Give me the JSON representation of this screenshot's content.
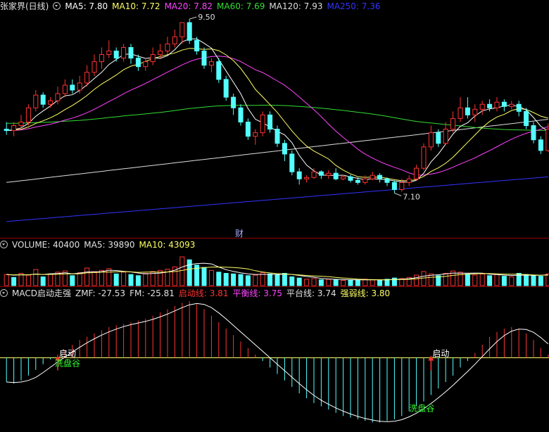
{
  "title": "张家界(日线)",
  "ma_legend": [
    {
      "label": "MA5: 7.80",
      "color": "#ffffff"
    },
    {
      "label": "MA10: 7.72",
      "color": "#ffff66"
    },
    {
      "label": "MA20: 7.82",
      "color": "#ff44ff"
    },
    {
      "label": "MA60: 7.69",
      "color": "#33dd33"
    },
    {
      "label": "MA120: 7.93",
      "color": "#dddddd"
    },
    {
      "label": "MA250: 7.36",
      "color": "#3333ff"
    }
  ],
  "volume_legend": [
    {
      "label": "VOLUME: 40400",
      "color": "#e0e0e0"
    },
    {
      "label": "MA5: 39890",
      "color": "#e0e0e0"
    },
    {
      "label": "MA10: 43093",
      "color": "#ffff66"
    }
  ],
  "macd_legend": [
    {
      "label": "MACD启动走强",
      "color": "#e0e0e0"
    },
    {
      "label": "ZMF: -27.53",
      "color": "#e0e0e0"
    },
    {
      "label": "FM: -25.81",
      "color": "#e0e0e0"
    },
    {
      "label": "启动线: 3.81",
      "color": "#ff3333"
    },
    {
      "label": "平衡线: 3.75",
      "color": "#ff44ff"
    },
    {
      "label": "平台线: 3.74",
      "color": "#e0e0e0"
    },
    {
      "label": "强弱线: 3.80",
      "color": "#ffff66"
    }
  ],
  "annotations": {
    "high": "9.50",
    "low": "7.10",
    "cai": "财",
    "qidong": "启动",
    "xipangu": "洗盘谷"
  },
  "colors": {
    "up": "#ff3333",
    "down": "#54ffff",
    "bg": "#000000"
  },
  "chart_data": [
    {
      "type": "candlestick",
      "ylim": [
        6.55,
        9.6
      ],
      "high_label": 9.5,
      "low_label": 7.1,
      "candles": [
        [
          8.0,
          7.98,
          8.1,
          7.92
        ],
        [
          7.98,
          8.05,
          8.1,
          7.9
        ],
        [
          8.05,
          8.1,
          8.2,
          8.0
        ],
        [
          8.1,
          8.3,
          8.35,
          8.05
        ],
        [
          8.3,
          8.48,
          8.55,
          8.25
        ],
        [
          8.48,
          8.35,
          8.52,
          8.3
        ],
        [
          8.35,
          8.4,
          8.45,
          8.3
        ],
        [
          8.4,
          8.5,
          8.6,
          8.35
        ],
        [
          8.5,
          8.62,
          8.7,
          8.45
        ],
        [
          8.62,
          8.55,
          8.7,
          8.5
        ],
        [
          8.55,
          8.65,
          8.75,
          8.5
        ],
        [
          8.65,
          8.8,
          8.9,
          8.6
        ],
        [
          8.8,
          8.95,
          9.05,
          8.75
        ],
        [
          8.95,
          9.05,
          9.15,
          8.85
        ],
        [
          9.05,
          9.1,
          9.25,
          9.0
        ],
        [
          9.1,
          9.0,
          9.15,
          8.95
        ],
        [
          9.0,
          9.15,
          9.2,
          8.95
        ],
        [
          9.15,
          9.0,
          9.2,
          8.92
        ],
        [
          9.0,
          8.88,
          9.05,
          8.82
        ],
        [
          8.88,
          8.95,
          9.0,
          8.82
        ],
        [
          8.95,
          9.05,
          9.15,
          8.9
        ],
        [
          9.05,
          9.1,
          9.2,
          9.0
        ],
        [
          9.1,
          9.2,
          9.3,
          9.05
        ],
        [
          9.2,
          9.3,
          9.4,
          9.15
        ],
        [
          9.3,
          9.5,
          9.5,
          9.2
        ],
        [
          9.5,
          9.25,
          9.55,
          9.2
        ],
        [
          9.25,
          9.1,
          9.3,
          9.05
        ],
        [
          9.1,
          8.9,
          9.15,
          8.85
        ],
        [
          8.9,
          8.95,
          9.0,
          8.8
        ],
        [
          8.95,
          8.7,
          9.0,
          8.65
        ],
        [
          8.7,
          8.45,
          8.75,
          8.4
        ],
        [
          8.45,
          8.3,
          8.5,
          8.2
        ],
        [
          8.3,
          8.1,
          8.35,
          8.05
        ],
        [
          8.1,
          7.9,
          8.15,
          7.85
        ],
        [
          7.9,
          7.95,
          8.0,
          7.78
        ],
        [
          7.95,
          8.2,
          8.25,
          7.9
        ],
        [
          8.2,
          8.0,
          8.25,
          7.95
        ],
        [
          8.0,
          7.8,
          8.05,
          7.75
        ],
        [
          7.8,
          7.65,
          7.85,
          7.55
        ],
        [
          7.65,
          7.4,
          7.7,
          7.35
        ],
        [
          7.4,
          7.3,
          7.45,
          7.22
        ],
        [
          7.3,
          7.32,
          7.35,
          7.25
        ],
        [
          7.32,
          7.4,
          7.45,
          7.3
        ],
        [
          7.4,
          7.35,
          7.42,
          7.3
        ],
        [
          7.35,
          7.38,
          7.42,
          7.3
        ],
        [
          7.38,
          7.3,
          7.45,
          7.28
        ],
        [
          7.3,
          7.33,
          7.36,
          7.28
        ],
        [
          7.33,
          7.28,
          7.36,
          7.25
        ],
        [
          7.28,
          7.25,
          7.32,
          7.22
        ],
        [
          7.25,
          7.3,
          7.35,
          7.22
        ],
        [
          7.3,
          7.35,
          7.4,
          7.28
        ],
        [
          7.35,
          7.3,
          7.38,
          7.25
        ],
        [
          7.3,
          7.25,
          7.32,
          7.2
        ],
        [
          7.25,
          7.15,
          7.28,
          7.1
        ],
        [
          7.15,
          7.25,
          7.3,
          7.12
        ],
        [
          7.25,
          7.3,
          7.35,
          7.2
        ],
        [
          7.3,
          7.45,
          7.5,
          7.28
        ],
        [
          7.45,
          7.75,
          7.8,
          7.42
        ],
        [
          7.75,
          7.95,
          8.05,
          7.7
        ],
        [
          7.95,
          7.8,
          8.0,
          7.75
        ],
        [
          7.8,
          8.0,
          8.1,
          7.78
        ],
        [
          8.0,
          8.15,
          8.25,
          7.95
        ],
        [
          8.15,
          8.3,
          8.45,
          8.1
        ],
        [
          8.3,
          8.2,
          8.45,
          8.15
        ],
        [
          8.2,
          8.28,
          8.35,
          8.1
        ],
        [
          8.28,
          8.35,
          8.4,
          8.2
        ],
        [
          8.35,
          8.3,
          8.42,
          8.25
        ],
        [
          8.3,
          8.38,
          8.45,
          8.25
        ],
        [
          8.38,
          8.32,
          8.42,
          8.25
        ],
        [
          8.32,
          8.35,
          8.4,
          8.28
        ],
        [
          8.35,
          8.25,
          8.4,
          8.18
        ],
        [
          8.25,
          8.05,
          8.3,
          8.0
        ],
        [
          8.05,
          7.85,
          8.1,
          7.8
        ],
        [
          7.85,
          7.7,
          7.9,
          7.65
        ],
        [
          7.7,
          8.0,
          8.08,
          7.68
        ]
      ]
    },
    {
      "type": "bar",
      "title": "VOLUME",
      "ylim": [
        0,
        115000
      ],
      "values": [
        38000,
        28000,
        42000,
        36000,
        55000,
        30000,
        40000,
        46000,
        50000,
        34000,
        44000,
        60000,
        48000,
        52000,
        58000,
        40000,
        46000,
        38000,
        34000,
        42000,
        48000,
        52000,
        56000,
        64000,
        98000,
        88000,
        70000,
        62000,
        52000,
        46000,
        42000,
        40000,
        38000,
        34000,
        36000,
        44000,
        40000,
        36000,
        42000,
        30000,
        26000,
        22000,
        24000,
        20000,
        22000,
        20000,
        18000,
        20000,
        18000,
        22000,
        20000,
        18000,
        22000,
        26000,
        24000,
        28000,
        36000,
        48000,
        40000,
        34000,
        42000,
        50000,
        46000,
        40000,
        36000,
        40000,
        34000,
        38000,
        32000,
        30000,
        42000,
        38000,
        34000,
        32000,
        40400
      ],
      "up": [
        true,
        false,
        true,
        true,
        true,
        false,
        true,
        true,
        true,
        false,
        true,
        true,
        true,
        true,
        true,
        false,
        true,
        false,
        false,
        true,
        true,
        true,
        true,
        true,
        true,
        false,
        false,
        false,
        true,
        false,
        false,
        false,
        false,
        false,
        true,
        true,
        false,
        false,
        false,
        false,
        false,
        true,
        true,
        false,
        true,
        false,
        true,
        false,
        false,
        true,
        true,
        false,
        false,
        false,
        true,
        true,
        true,
        true,
        true,
        false,
        true,
        true,
        true,
        false,
        true,
        true,
        false,
        true,
        false,
        true,
        false,
        false,
        false,
        false,
        true
      ]
    },
    {
      "type": "bar",
      "title": "MACD启动走强",
      "ylim": [
        -90,
        70
      ],
      "values": [
        -30,
        -32,
        -28,
        -22,
        -15,
        -8,
        -2,
        4,
        10,
        16,
        22,
        26,
        30,
        34,
        38,
        40,
        42,
        44,
        46,
        48,
        52,
        56,
        60,
        64,
        68,
        70,
        66,
        60,
        52,
        44,
        36,
        28,
        20,
        12,
        4,
        -4,
        -12,
        -20,
        -28,
        -36,
        -44,
        -50,
        -56,
        -60,
        -64,
        -68,
        -72,
        -74,
        -76,
        -78,
        -80,
        -80,
        -78,
        -76,
        -72,
        -66,
        -60,
        -54,
        -46,
        -38,
        -30,
        -22,
        -12,
        -4,
        6,
        16,
        26,
        32,
        36,
        38,
        36,
        30,
        22,
        12,
        4
      ]
    }
  ]
}
